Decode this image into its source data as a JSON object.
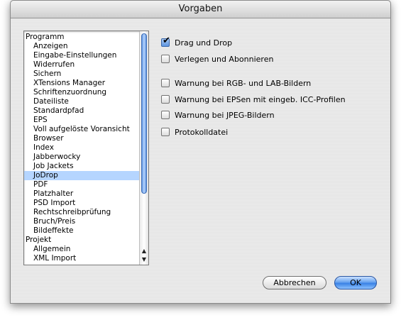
{
  "window": {
    "title": "Vorgaben"
  },
  "sidebar": {
    "items": [
      {
        "label": "Programm",
        "level": 0,
        "selected": false
      },
      {
        "label": "Anzeigen",
        "level": 1,
        "selected": false
      },
      {
        "label": "Eingabe-Einstellungen",
        "level": 1,
        "selected": false
      },
      {
        "label": "Widerrufen",
        "level": 1,
        "selected": false
      },
      {
        "label": "Sichern",
        "level": 1,
        "selected": false
      },
      {
        "label": "XTensions Manager",
        "level": 1,
        "selected": false
      },
      {
        "label": "Schriftenzuordnung",
        "level": 1,
        "selected": false
      },
      {
        "label": "Dateiliste",
        "level": 1,
        "selected": false
      },
      {
        "label": "Standardpfad",
        "level": 1,
        "selected": false
      },
      {
        "label": "EPS",
        "level": 1,
        "selected": false
      },
      {
        "label": "Voll aufgelöste Voransicht",
        "level": 1,
        "selected": false
      },
      {
        "label": "Browser",
        "level": 1,
        "selected": false
      },
      {
        "label": "Index",
        "level": 1,
        "selected": false
      },
      {
        "label": "Jabberwocky",
        "level": 1,
        "selected": false
      },
      {
        "label": "Job Jackets",
        "level": 1,
        "selected": false
      },
      {
        "label": "JoDrop",
        "level": 1,
        "selected": true
      },
      {
        "label": "PDF",
        "level": 1,
        "selected": false
      },
      {
        "label": "Platzhalter",
        "level": 1,
        "selected": false
      },
      {
        "label": "PSD Import",
        "level": 1,
        "selected": false
      },
      {
        "label": "Rechtschreibprüfung",
        "level": 1,
        "selected": false
      },
      {
        "label": "Bruch/Preis",
        "level": 1,
        "selected": false
      },
      {
        "label": "Bildeffekte",
        "level": 1,
        "selected": false
      },
      {
        "label": "Projekt",
        "level": 0,
        "selected": false
      },
      {
        "label": "Allgemein",
        "level": 1,
        "selected": false
      },
      {
        "label": "XML Import",
        "level": 1,
        "selected": false
      }
    ]
  },
  "options": [
    {
      "label": "Drag und Drop",
      "checked": true
    },
    {
      "label": "Verlegen und Abonnieren",
      "checked": false
    },
    {
      "label": "Warnung bei RGB- und LAB-Bildern",
      "checked": false
    },
    {
      "label": "Warnung bei EPSen mit eingeb. ICC-Profilen",
      "checked": false
    },
    {
      "label": "Warnung bei JPEG-Bildern",
      "checked": false
    },
    {
      "label": "Protokolldatei",
      "checked": false
    }
  ],
  "icons": {
    "check": "checkmark-icon",
    "scroll_up": "scroll-up-arrow-icon",
    "scroll_down": "scroll-down-arrow-icon"
  },
  "buttons": {
    "cancel_label": "Abbrechen",
    "ok_label": "OK"
  },
  "colors": {
    "selection": "#b5d5ff",
    "accent": "#3a82e5"
  }
}
